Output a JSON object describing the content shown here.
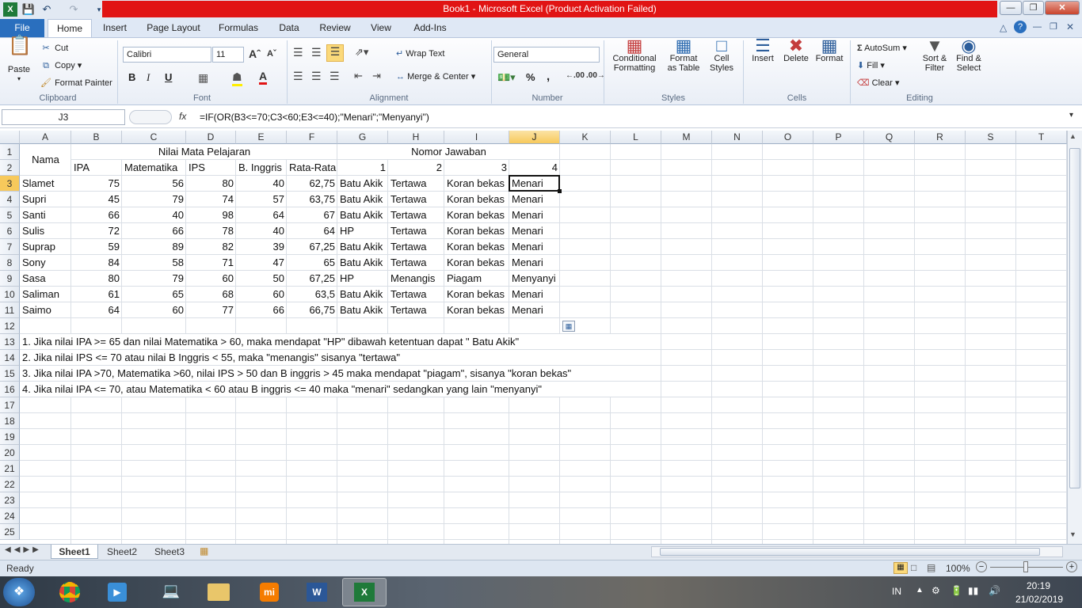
{
  "window": {
    "title": "Book1 - Microsoft Excel (Product Activation Failed)"
  },
  "qat": {
    "save_icon": "save-icon",
    "undo_icon": "undo-icon",
    "redo_icon": "redo-icon"
  },
  "tabs": [
    "Home",
    "Insert",
    "Page Layout",
    "Formulas",
    "Data",
    "Review",
    "View",
    "Add-Ins"
  ],
  "file_tab": "File",
  "ribbon": {
    "clipboard": {
      "paste": "Paste",
      "cut": "Cut",
      "copy": "Copy",
      "format_painter": "Format Painter",
      "label": "Clipboard"
    },
    "font": {
      "name": "Calibri",
      "size": "11",
      "bold": "B",
      "italic": "I",
      "underline": "U",
      "label": "Font"
    },
    "alignment": {
      "wrap": "Wrap Text",
      "merge": "Merge & Center",
      "label": "Alignment"
    },
    "number": {
      "format": "General",
      "percent": "%",
      "comma": ",",
      "label": "Number"
    },
    "styles": {
      "conditional": [
        "Conditional",
        "Formatting"
      ],
      "table": [
        "Format",
        "as Table"
      ],
      "cell": [
        "Cell",
        "Styles"
      ],
      "label": "Styles"
    },
    "cells": {
      "insert": "Insert",
      "delete": "Delete",
      "format": "Format",
      "label": "Cells"
    },
    "editing": {
      "autosum": "AutoSum",
      "fill": "Fill",
      "clear": "Clear",
      "sort": [
        "Sort &",
        "Filter"
      ],
      "find": [
        "Find &",
        "Select"
      ],
      "label": "Editing"
    }
  },
  "formula_bar": {
    "name_box": "J3",
    "fx": "fx",
    "formula": "=IF(OR(B3<=70;C3<60;E3<=40);\"Menari\";\"Menyanyi\")"
  },
  "columns": [
    "A",
    "B",
    "C",
    "D",
    "E",
    "F",
    "G",
    "H",
    "I",
    "J",
    "K",
    "L",
    "M",
    "N",
    "O",
    "P",
    "Q",
    "R",
    "S",
    "T"
  ],
  "rows": [
    "1",
    "2",
    "3",
    "4",
    "5",
    "6",
    "7",
    "8",
    "9",
    "10",
    "11",
    "12",
    "13",
    "14",
    "15",
    "16",
    "17",
    "18",
    "19",
    "20",
    "21",
    "22",
    "23",
    "24",
    "25"
  ],
  "header": {
    "nama": "Nama",
    "nilai": "Nilai Mata Pelajaran",
    "nomor": "Nomor Jawaban",
    "sub": [
      "IPA",
      "Matematika",
      "IPS",
      "B. Inggris",
      "Rata-Rata",
      "1",
      "2",
      "3",
      "4"
    ]
  },
  "table_rows": [
    [
      "Slamet",
      "75",
      "56",
      "80",
      "40",
      "62,75",
      "Batu Akik",
      "Tertawa",
      "Koran bekas",
      "Menari"
    ],
    [
      "Supri",
      "45",
      "79",
      "74",
      "57",
      "63,75",
      "Batu Akik",
      "Tertawa",
      "Koran bekas",
      "Menari"
    ],
    [
      "Santi",
      "66",
      "40",
      "98",
      "64",
      "67",
      "Batu Akik",
      "Tertawa",
      "Koran bekas",
      "Menari"
    ],
    [
      "Sulis",
      "72",
      "66",
      "78",
      "40",
      "64",
      "HP",
      "Tertawa",
      "Koran bekas",
      "Menari"
    ],
    [
      "Suprap",
      "59",
      "89",
      "82",
      "39",
      "67,25",
      "Batu Akik",
      "Tertawa",
      "Koran bekas",
      "Menari"
    ],
    [
      "Sony",
      "84",
      "58",
      "71",
      "47",
      "65",
      "Batu Akik",
      "Tertawa",
      "Koran bekas",
      "Menari"
    ],
    [
      "Sasa",
      "80",
      "79",
      "60",
      "50",
      "67,25",
      "HP",
      "Menangis",
      "Piagam",
      "Menyanyi"
    ],
    [
      "Saliman",
      "61",
      "65",
      "68",
      "60",
      "63,5",
      "Batu Akik",
      "Tertawa",
      "Koran bekas",
      "Menari"
    ],
    [
      "Saimo",
      "64",
      "60",
      "77",
      "66",
      "66,75",
      "Batu Akik",
      "Tertawa",
      "Koran bekas",
      "Menari"
    ]
  ],
  "notes": [
    "1. Jika nilai IPA >= 65 dan nilai Matematika > 60, maka mendapat \"HP\" dibawah ketentuan dapat \" Batu Akik\"",
    "2. Jika nilai IPS <= 70 atau nilai B Inggris < 55, maka \"menangis\" sisanya \"tertawa\"",
    "3. Jika nilai IPA >70, Matematika >60, nilai IPS > 50 dan B inggris > 45 maka mendapat \"piagam\", sisanya \"koran bekas\"",
    "4. Jika nilai IPA <= 70, atau Matematika < 60 atau B inggris <= 40 maka \"menari\" sedangkan yang lain \"menyanyi\""
  ],
  "sheets": [
    "Sheet1",
    "Sheet2",
    "Sheet3"
  ],
  "status": {
    "ready": "Ready",
    "zoom": "100%"
  },
  "taskbar": {
    "lang": "IN",
    "time": "20:19",
    "date": "21/02/2019"
  },
  "colors": {
    "title_bar_error": "#e11414",
    "selected_header": "#f7c95b",
    "file_tab": "#2a6fbe"
  }
}
